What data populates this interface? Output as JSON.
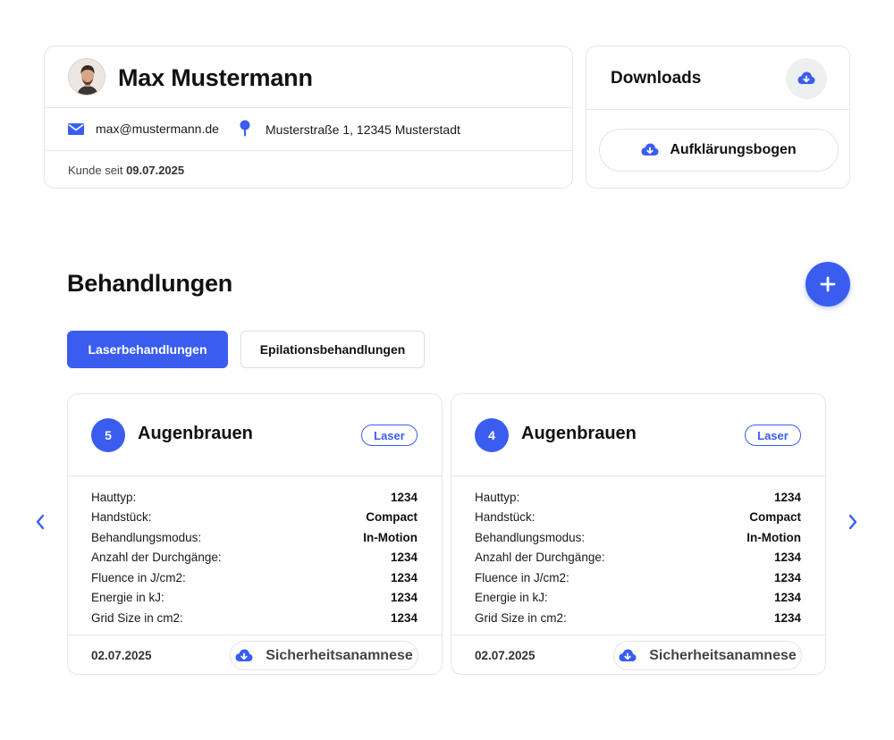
{
  "profile": {
    "name": "Max Mustermann",
    "email": "max@mustermann.de",
    "address": "Musterstraße 1, 12345 Musterstadt",
    "customer_since_label": "Kunde seit",
    "customer_since_date": "09.07.2025"
  },
  "downloads": {
    "title": "Downloads",
    "button_label": "Aufklärungsbogen",
    "icon": "cloud-download-icon"
  },
  "treatments": {
    "title": "Behandlungen",
    "add_icon": "plus-icon",
    "tabs": [
      {
        "label": "Laserbehandlungen",
        "active": true
      },
      {
        "label": "Epilationsbehandlungen",
        "active": false
      }
    ],
    "cards": [
      {
        "number": "5",
        "title": "Augenbrauen",
        "tag": "Laser",
        "attributes": [
          {
            "label": "Hauttyp:",
            "value": "1234"
          },
          {
            "label": "Handstück:",
            "value": "Compact"
          },
          {
            "label": "Behandlungsmodus:",
            "value": "In-Motion"
          },
          {
            "label": "Anzahl der Durchgänge:",
            "value": "1234"
          },
          {
            "label": "Fluence in J/cm2:",
            "value": "1234"
          },
          {
            "label": "Energie in kJ:",
            "value": "1234"
          },
          {
            "label": "Grid Size in cm2:",
            "value": "1234"
          }
        ],
        "date": "02.07.2025",
        "action_label": "Sicherheitsanamnese"
      },
      {
        "number": "4",
        "title": "Augenbrauen",
        "tag": "Laser",
        "attributes": [
          {
            "label": "Hauttyp:",
            "value": "1234"
          },
          {
            "label": "Handstück:",
            "value": "Compact"
          },
          {
            "label": "Behandlungsmodus:",
            "value": "In-Motion"
          },
          {
            "label": "Anzahl der Durchgänge:",
            "value": "1234"
          },
          {
            "label": "Fluence in J/cm2:",
            "value": "1234"
          },
          {
            "label": "Energie in kJ:",
            "value": "1234"
          },
          {
            "label": "Grid Size in cm2:",
            "value": "1234"
          }
        ],
        "date": "02.07.2025",
        "action_label": "Sicherheitsanamnese"
      }
    ]
  },
  "colors": {
    "accent": "#3a5df0",
    "border": "#e4e6ea",
    "text": "#111111"
  }
}
